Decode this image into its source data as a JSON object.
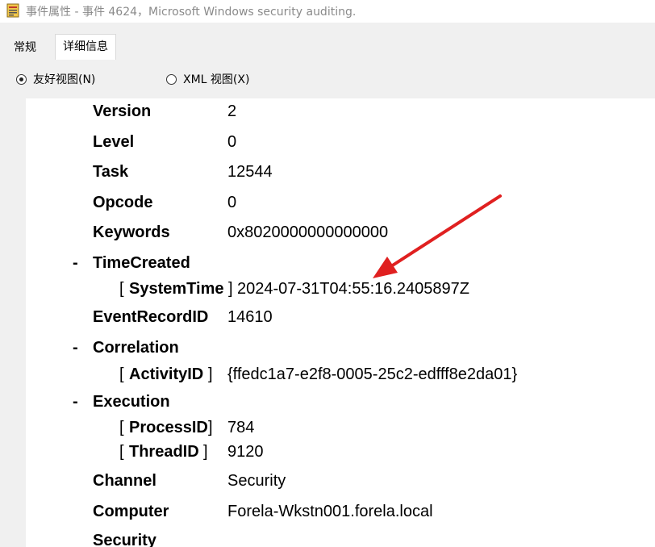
{
  "window": {
    "title": "事件属性 - 事件 4624，Microsoft Windows security auditing."
  },
  "tabs": [
    {
      "label": "常规"
    },
    {
      "label": "详细信息"
    }
  ],
  "view_options": {
    "friendly": "友好视图(N)",
    "xml": "XML 视图(X)",
    "selected": "friendly"
  },
  "details": {
    "version": {
      "key": "Version",
      "value": "2"
    },
    "level": {
      "key": "Level",
      "value": "0"
    },
    "task": {
      "key": "Task",
      "value": "12544"
    },
    "opcode": {
      "key": "Opcode",
      "value": "0"
    },
    "keywords": {
      "key": "Keywords",
      "value": "0x8020000000000000"
    },
    "time_created": {
      "collapse": "-",
      "key": "TimeCreated",
      "system_time_open": "[",
      "system_time_key": "SystemTime",
      "system_time_close": "]",
      "system_time_value": "2024-07-31T04:55:16.2405897Z"
    },
    "event_record_id": {
      "key": "EventRecordID",
      "value": "14610"
    },
    "correlation": {
      "collapse": "-",
      "key": "Correlation",
      "activity_open": "[",
      "activity_key": "ActivityID",
      "activity_close": "]",
      "activity_value": "{ffedc1a7-e2f8-0005-25c2-edfff8e2da01}"
    },
    "execution": {
      "collapse": "-",
      "key": "Execution",
      "process_open": "[",
      "process_key": "ProcessID",
      "process_close": "]",
      "process_value": "784",
      "thread_open": "[",
      "thread_key": "ThreadID",
      "thread_close": "]",
      "thread_value": "9120"
    },
    "channel": {
      "key": "Channel",
      "value": "Security"
    },
    "computer": {
      "key": "Computer",
      "value": "Forela-Wkstn001.forela.local"
    },
    "security": {
      "key": "Security"
    }
  },
  "annotation": {
    "arrow_color": "#e02020",
    "icon": "red-arrow-icon"
  }
}
